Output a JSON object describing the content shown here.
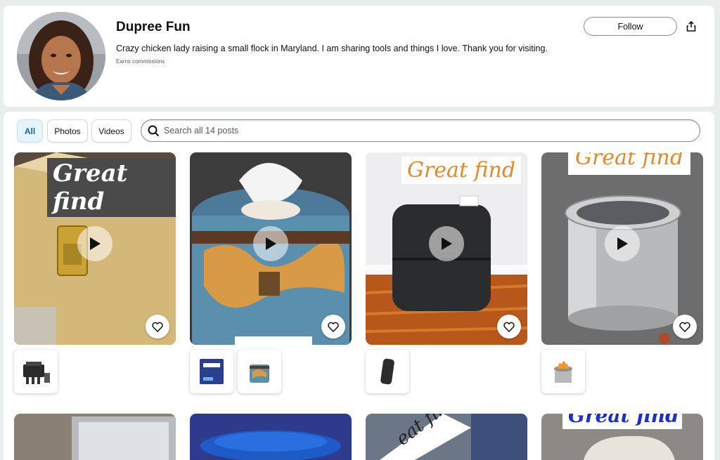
{
  "profile": {
    "name": "Dupree Fun",
    "bio": "Crazy chicken lady raising a small flock in Maryland. I am sharing tools and things I love. Thank you for visiting.",
    "note": "Earns commissions",
    "follow_label": "Follow"
  },
  "filters": {
    "all": "All",
    "photos": "Photos",
    "videos": "Videos"
  },
  "search": {
    "placeholder": "Search all 14 posts"
  },
  "posts": [
    {
      "caption": "Great find",
      "icon": "play-icon",
      "thumbnails": [
        "tool-case-icon"
      ]
    },
    {
      "caption": "",
      "icon": "play-icon",
      "thumbnails": [
        "kleenex-box-icon",
        "tissue-cover-icon"
      ]
    },
    {
      "caption": "Great find",
      "icon": "play-icon",
      "thumbnails": [
        "black-bag-icon"
      ]
    },
    {
      "caption": "Great find",
      "icon": "play-icon",
      "thumbnails": [
        "fire-pit-icon"
      ]
    },
    {
      "caption": "",
      "icon": "image"
    },
    {
      "caption": "",
      "icon": "image"
    },
    {
      "caption": "eat finds",
      "icon": "image"
    },
    {
      "caption": "Great find",
      "icon": "image"
    }
  ],
  "colors": {
    "accent": "#2162a1",
    "active_tab_bg": "#e6f4fb",
    "caption_orange": "#e08a2c"
  }
}
